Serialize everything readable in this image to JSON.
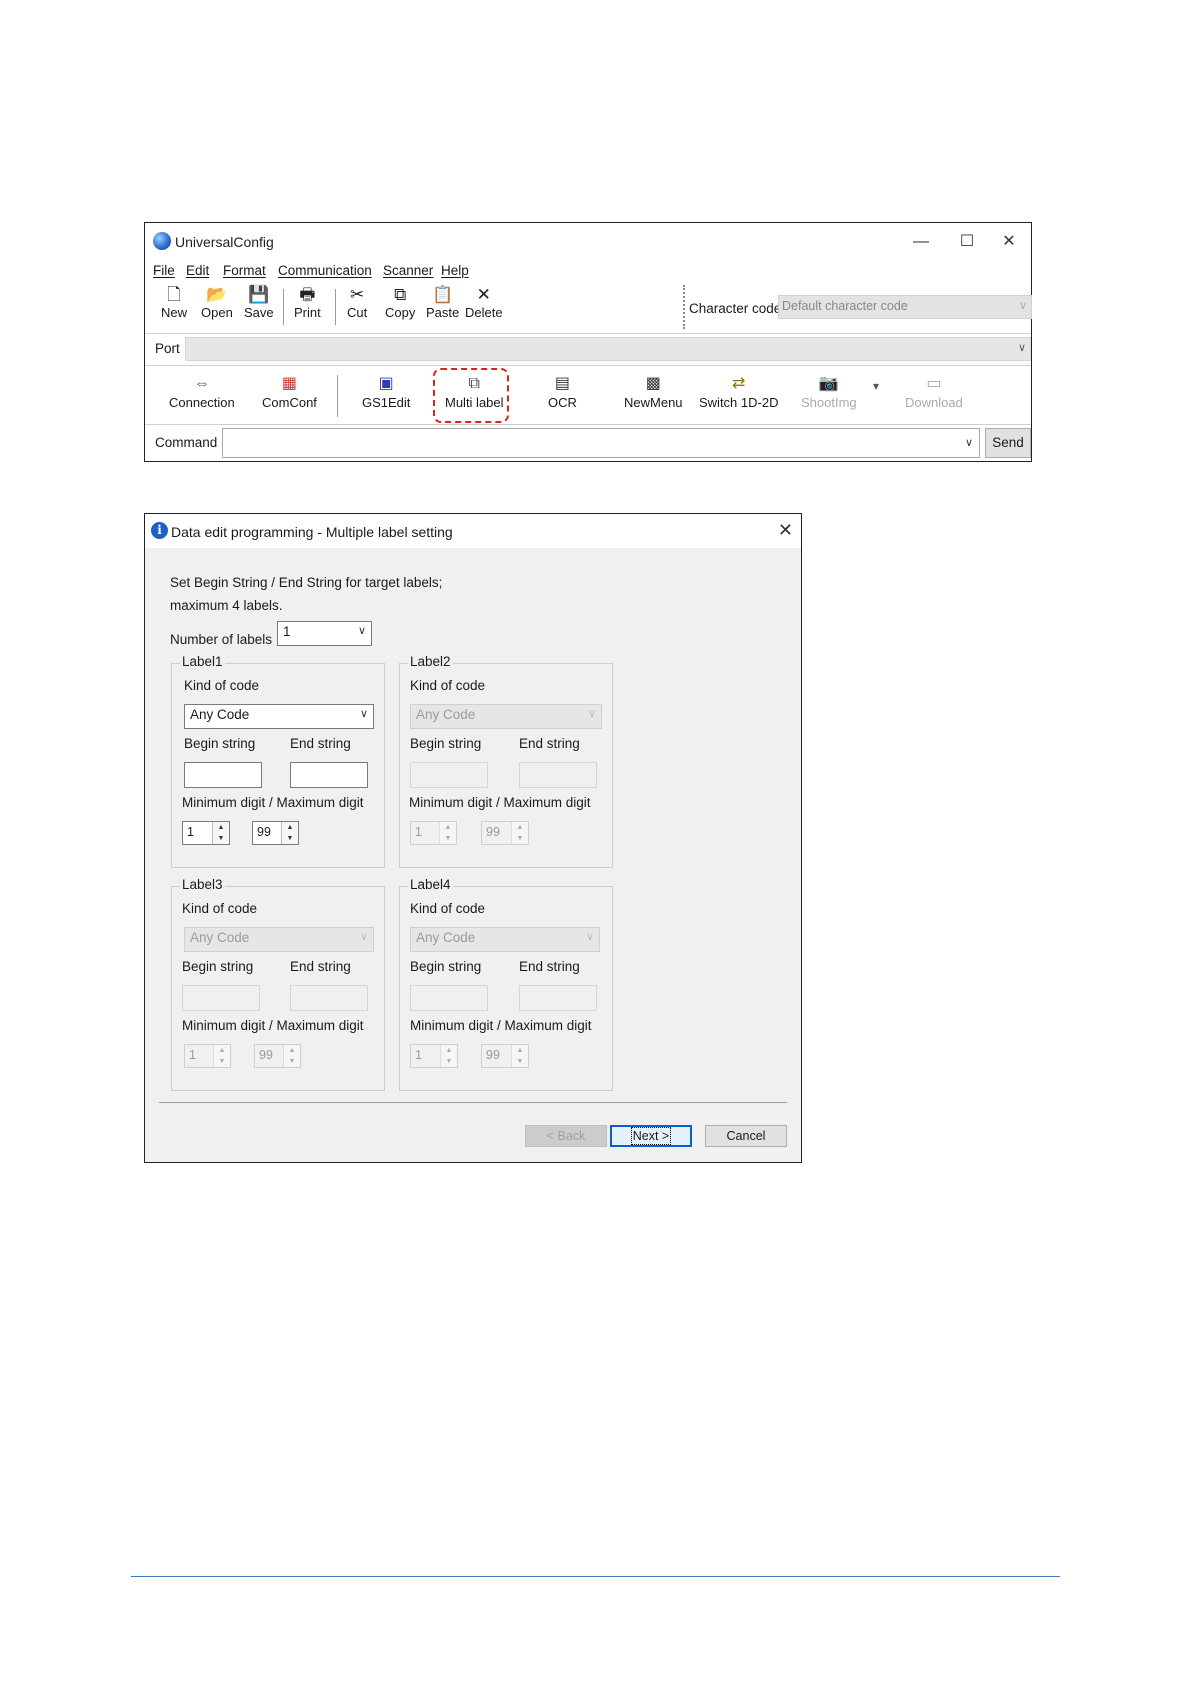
{
  "main_window": {
    "title": "UniversalConfig",
    "controls": {
      "minimize": "—",
      "maximize": "☐",
      "close": "✕"
    },
    "menu": [
      "File",
      "Edit",
      "Format",
      "Communication",
      "Scanner",
      "Help"
    ],
    "toolbar": [
      {
        "label": "New",
        "icon": "new-file-icon",
        "glyph": "🗋"
      },
      {
        "label": "Open",
        "icon": "open-folder-icon",
        "glyph": "📂"
      },
      {
        "label": "Save",
        "icon": "save-disk-icon",
        "glyph": "💾"
      },
      {
        "label": "Print",
        "icon": "printer-icon",
        "glyph": "🖶"
      },
      {
        "label": "Cut",
        "icon": "scissors-icon",
        "glyph": "✂"
      },
      {
        "label": "Copy",
        "icon": "copy-icon",
        "glyph": "⧉"
      },
      {
        "label": "Paste",
        "icon": "clipboard-icon",
        "glyph": "📋"
      },
      {
        "label": "Delete",
        "icon": "delete-x-icon",
        "glyph": "✕"
      }
    ],
    "character_code": {
      "label": "Character code",
      "value": "Default character code"
    },
    "port": {
      "label": "Port",
      "value": ""
    },
    "function_buttons": [
      {
        "label": "Connection",
        "icon": "connection-icon",
        "glyph": "⇔",
        "disabled": false
      },
      {
        "label": "ComConf",
        "icon": "comconf-icon",
        "glyph": "▦",
        "disabled": false
      },
      {
        "label": "GS1Edit",
        "icon": "gs1-icon",
        "glyph": "▣",
        "disabled": false
      },
      {
        "label": "Multi label",
        "icon": "multi-label-icon",
        "glyph": "⧉",
        "disabled": false,
        "highlighted": true
      },
      {
        "label": "OCR",
        "icon": "ocr-icon",
        "glyph": "▤",
        "disabled": false
      },
      {
        "label": "NewMenu",
        "icon": "new-menu-icon",
        "glyph": "▩",
        "disabled": false
      },
      {
        "label": "Switch 1D-2D",
        "icon": "switch-icon",
        "glyph": "⇄",
        "disabled": false
      },
      {
        "label": "ShootImg",
        "icon": "camera-icon",
        "glyph": "📷",
        "disabled": true
      },
      {
        "label": "Download",
        "icon": "download-icon",
        "glyph": "▭",
        "disabled": true
      }
    ],
    "dropdown_arrow": "▾",
    "command": {
      "label": "Command",
      "value": "",
      "send": "Send"
    }
  },
  "dialog": {
    "title": "Data edit programming - Multiple label setting",
    "description_line1": "Set Begin String / End String for target labels;",
    "description_line2": "maximum 4 labels.",
    "number_of_labels": {
      "label": "Number of labels",
      "value": "1"
    },
    "field_labels": {
      "kind": "Kind of code",
      "begin": "Begin string",
      "end": "End string",
      "minmax": "Minimum digit / Maximum digit"
    },
    "labels": [
      {
        "name": "Label1",
        "kind": "Any Code",
        "begin": "",
        "end": "",
        "min": "1",
        "max": "99",
        "enabled": true
      },
      {
        "name": "Label2",
        "kind": "Any Code",
        "begin": "",
        "end": "",
        "min": "1",
        "max": "99",
        "enabled": false
      },
      {
        "name": "Label3",
        "kind": "Any Code",
        "begin": "",
        "end": "",
        "min": "1",
        "max": "99",
        "enabled": false
      },
      {
        "name": "Label4",
        "kind": "Any Code",
        "begin": "",
        "end": "",
        "min": "1",
        "max": "99",
        "enabled": false
      }
    ],
    "buttons": {
      "back": "< Back",
      "next": "Next >",
      "cancel": "Cancel"
    }
  }
}
